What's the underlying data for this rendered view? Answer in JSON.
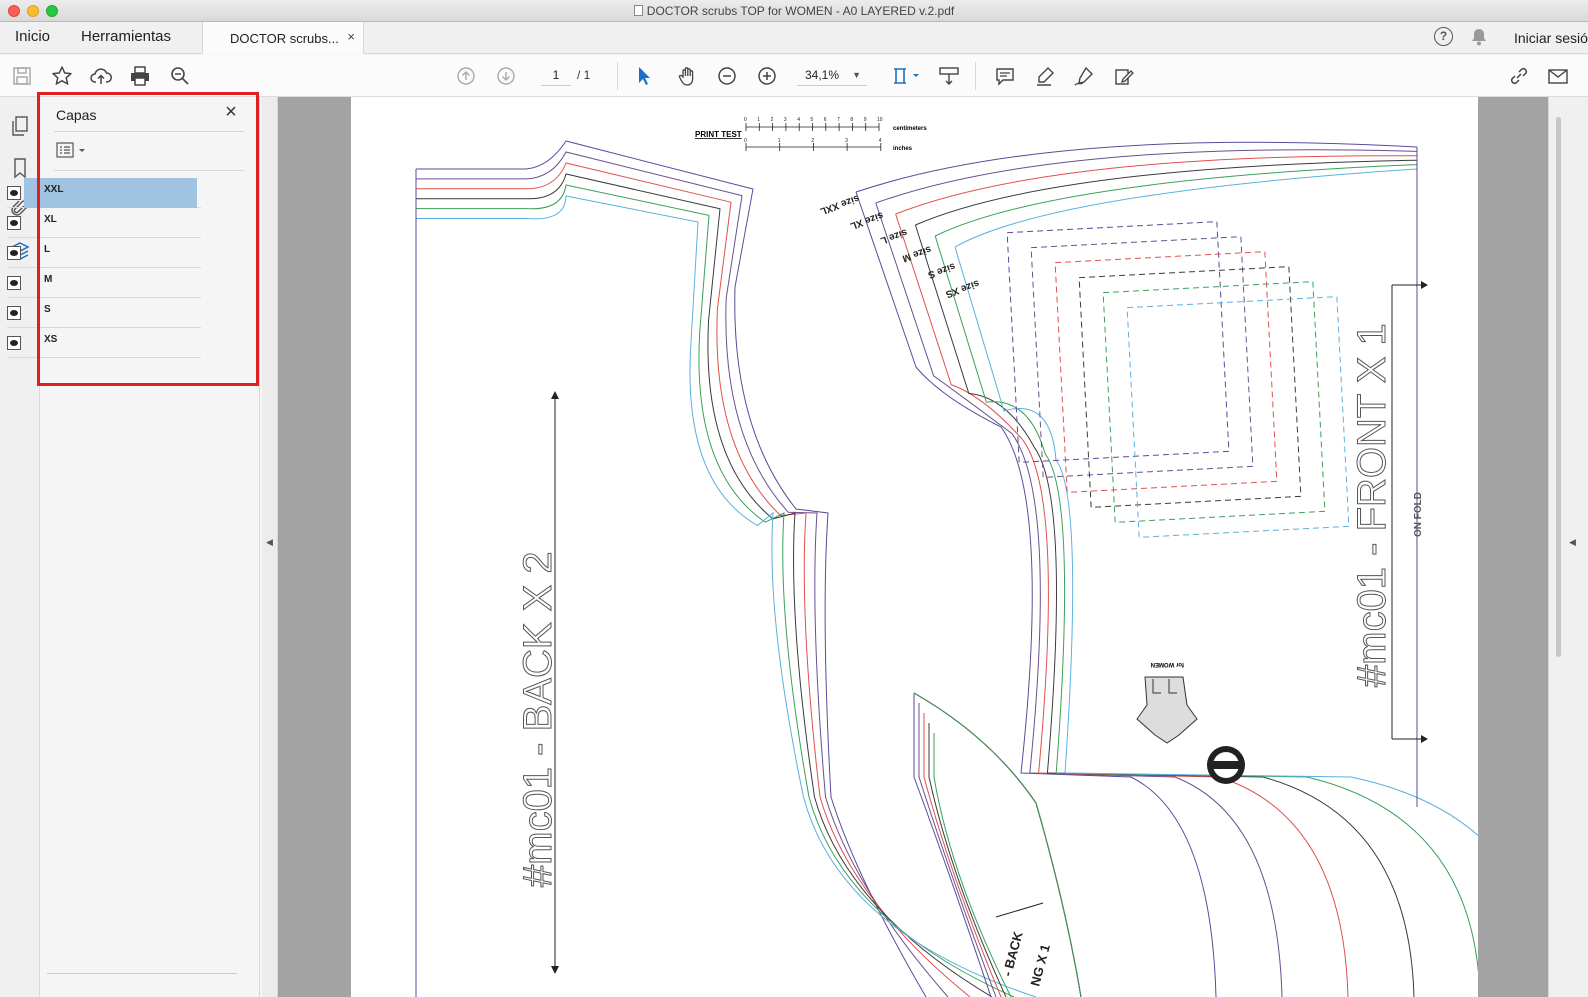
{
  "window": {
    "title": "DOCTOR scrubs TOP for WOMEN - A0 LAYERED v.2.pdf"
  },
  "nav": {
    "home": "Inicio",
    "tools": "Herramientas",
    "doc_tab": "DOCTOR scrubs...",
    "doc_tab_close": "×",
    "signin": "Iniciar sesión"
  },
  "toolbar": {
    "page_current": "1",
    "page_total": "/ 1",
    "zoom": "34,1%"
  },
  "panel": {
    "title": "Capas",
    "close": "×",
    "layers": [
      {
        "name": "XXL",
        "selected": true
      },
      {
        "name": "XL"
      },
      {
        "name": "L"
      },
      {
        "name": "M"
      },
      {
        "name": "S"
      },
      {
        "name": "XS"
      }
    ]
  },
  "document": {
    "print_test": "PRINT TEST",
    "cm_label": "centimeters",
    "in_label": "inches",
    "cm_ticks": [
      "0",
      "1",
      "2",
      "3",
      "4",
      "5",
      "6",
      "7",
      "8",
      "9",
      "10"
    ],
    "in_ticks": [
      "0",
      "1",
      "2",
      "3",
      "4"
    ],
    "back_label": "#mc01 - BACK X 2",
    "front_label": "#mc01 - FRONT X 1",
    "on_fold": "ON FOLD",
    "small_piece_label": "- BACK",
    "small_piece_label2": "NG X 1",
    "for_women": "for WOMEN",
    "size_labels": [
      "size XXL",
      "size XL",
      "size L",
      "size M",
      "size S",
      "size XS"
    ],
    "size_colors": [
      "#5b4a9c",
      "#6a4f8f",
      "#e0504a",
      "#3a3a3a",
      "#3aa05a",
      "#5ab0e0"
    ]
  }
}
